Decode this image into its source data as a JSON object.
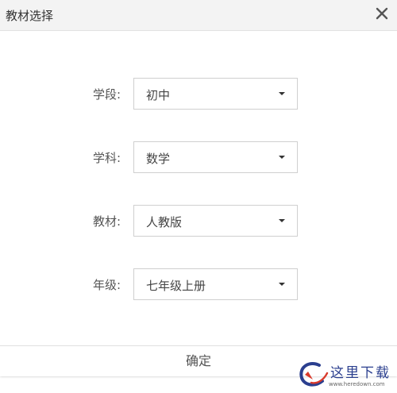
{
  "dialog": {
    "title": "教材选择",
    "close_icon": "close-icon",
    "confirm_label": "确定"
  },
  "form": {
    "rows": [
      {
        "label": "学段:",
        "value": "初中"
      },
      {
        "label": "学科:",
        "value": "数学"
      },
      {
        "label": "教材:",
        "value": "人教版"
      },
      {
        "label": "年级:",
        "value": "七年级上册"
      }
    ]
  },
  "watermark": {
    "text": "这里下载",
    "url": "www.heredown.com"
  },
  "colors": {
    "titlebar_bg": "#f3f3f3",
    "border": "#cfcfcf",
    "watermark_blue": "#2b3f8f",
    "watermark_red": "#d93a2b"
  }
}
